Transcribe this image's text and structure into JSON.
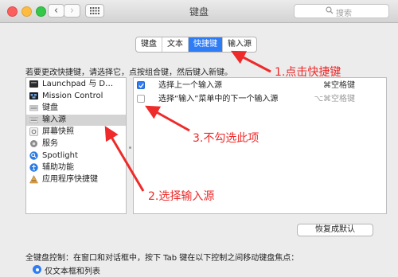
{
  "window": {
    "title": "键盘",
    "search_placeholder": "搜索",
    "nav_back": "‹",
    "nav_forward": "›"
  },
  "tabs": [
    {
      "label": "键盘",
      "active": false
    },
    {
      "label": "文本",
      "active": false
    },
    {
      "label": "快捷键",
      "active": true
    },
    {
      "label": "输入源",
      "active": false
    }
  ],
  "instruction": "若要更改快捷键，请选择它，点按组合键，然后键入新键。",
  "categories": [
    {
      "label": "Launchpad 与 D…",
      "icon": "launchpad-icon",
      "selected": false
    },
    {
      "label": "Mission Control",
      "icon": "mission-control-icon",
      "selected": false
    },
    {
      "label": "键盘",
      "icon": "keyboard-icon",
      "selected": false
    },
    {
      "label": "输入源",
      "icon": "input-source-icon",
      "selected": true
    },
    {
      "label": "屏幕快照",
      "icon": "screenshot-icon",
      "selected": false
    },
    {
      "label": "服务",
      "icon": "services-gear-icon",
      "selected": false
    },
    {
      "label": "Spotlight",
      "icon": "spotlight-icon",
      "selected": false
    },
    {
      "label": "辅助功能",
      "icon": "accessibility-icon",
      "selected": false
    },
    {
      "label": "应用程序快捷键",
      "icon": "app-shortcuts-icon",
      "selected": false
    }
  ],
  "shortcuts": [
    {
      "checked": true,
      "label": "选择上一个输入源",
      "key": "⌘空格键",
      "enabled": true
    },
    {
      "checked": false,
      "label": "选择“输入”菜单中的下一个输入源",
      "key": "⌥⌘空格键",
      "enabled": false
    }
  ],
  "restore_button": "恢复成默认",
  "full_keyboard_label": "全键盘控制：在窗口和对话框中，按下 Tab 键在以下控制之间移动键盘焦点：",
  "radio_option": "仅文本框和列表",
  "annotations": {
    "step1": "1.点击快捷键",
    "step2": "2.选择输入源",
    "step3": "3.不勾选此项"
  },
  "colors": {
    "accent": "#2e7cf6",
    "annotation": "#ee2a2a"
  }
}
